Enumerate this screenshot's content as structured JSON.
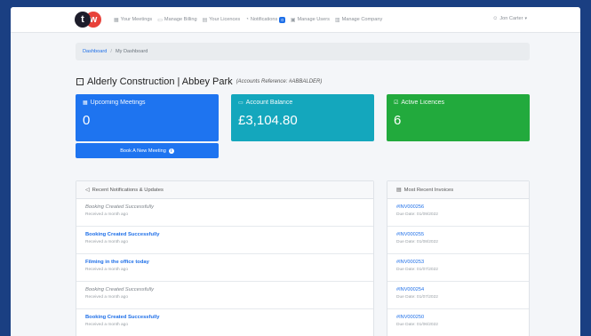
{
  "brand": {
    "t": "t",
    "w": "w"
  },
  "nav": {
    "items": [
      {
        "icon": "calendar-icon",
        "glyph": "▦",
        "label": "Your Meetings"
      },
      {
        "icon": "billing-icon",
        "glyph": "▭",
        "label": "Manage Billing"
      },
      {
        "icon": "licence-icon",
        "glyph": "▤",
        "label": "Your Licences"
      },
      {
        "icon": "bell-icon",
        "glyph": "◔",
        "label": "Notifications"
      },
      {
        "icon": "users-icon",
        "glyph": "▣",
        "label": "Manage Users"
      },
      {
        "icon": "building-icon",
        "glyph": "▥",
        "label": "Manage Company"
      }
    ],
    "notifications_badge": "0",
    "user_name": "Jon Carter"
  },
  "breadcrumb": {
    "home": "Dashboard",
    "separator": "/",
    "current": "My Dashboard"
  },
  "page": {
    "title": "Alderly Construction | Abbey Park",
    "reference": "(Accounts Reference: #ABBALDER)"
  },
  "cards": {
    "meetings": {
      "label": "Upcoming Meetings",
      "value": "0"
    },
    "balance": {
      "label": "Account Balance",
      "value": "£3,104.80"
    },
    "licences": {
      "label": "Active Licences",
      "value": "6"
    }
  },
  "book_button": {
    "label": "Book A New Meeting"
  },
  "notifications": {
    "header": "Recent Notifications & Updates",
    "items": [
      {
        "title": "Booking Created Successfully",
        "time": "Received a month ago",
        "style": "muted"
      },
      {
        "title": "Booking Created Successfully",
        "time": "Received a month ago",
        "style": "link"
      },
      {
        "title": "Filming in the office today",
        "time": "Received a month ago",
        "style": "link"
      },
      {
        "title": "Booking Created Successfully",
        "time": "Received a month ago",
        "style": "muted"
      },
      {
        "title": "Booking Created Successfully",
        "time": "Received a month ago",
        "style": "link"
      }
    ]
  },
  "invoices": {
    "header": "Most Recent Invoices",
    "items": [
      {
        "number": "#INV000256",
        "due": "Due Date: 01/09/2022"
      },
      {
        "number": "#INV000255",
        "due": "Due Date: 01/08/2022"
      },
      {
        "number": "#INV000253",
        "due": "Due Date: 01/07/2022"
      },
      {
        "number": "#INV000254",
        "due": "Due Date: 01/07/2022"
      },
      {
        "number": "#INV000250",
        "due": "Due Date: 01/06/2022"
      }
    ]
  },
  "colors": {
    "primary": "#1e74f0",
    "info": "#14a7bd",
    "success": "#22aa3d",
    "background": "#1a3f82"
  }
}
